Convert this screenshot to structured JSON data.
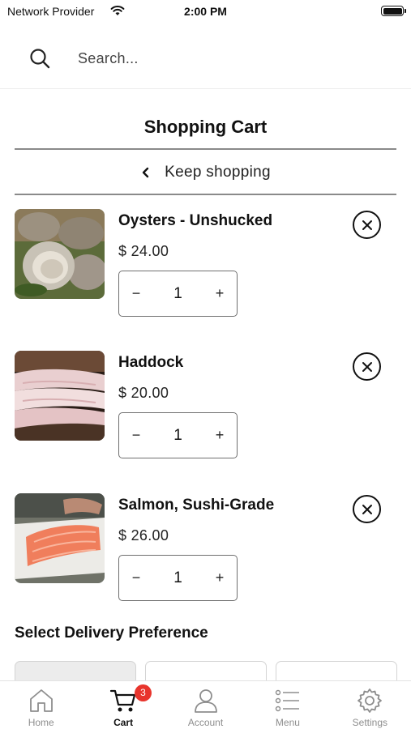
{
  "status_bar": {
    "carrier": "Network Provider",
    "time": "2:00 PM"
  },
  "search": {
    "placeholder": "Search...",
    "icon": "search-icon"
  },
  "header": {
    "title": "Shopping Cart",
    "keep_shopping": "Keep shopping"
  },
  "cart": {
    "items": [
      {
        "name": "Oysters - Unshucked",
        "price": "$ 24.00",
        "quantity": "1",
        "image": "oysters-photo"
      },
      {
        "name": "Haddock",
        "price": "$ 20.00",
        "quantity": "1",
        "image": "haddock-photo"
      },
      {
        "name": "Salmon, Sushi-Grade",
        "price": "$ 26.00",
        "quantity": "1",
        "image": "salmon-photo"
      }
    ],
    "decrement_symbol": "−",
    "increment_symbol": "+"
  },
  "delivery": {
    "title": "Select Delivery Preference"
  },
  "tab_bar": {
    "tabs": [
      {
        "label": "Home",
        "icon": "home-icon"
      },
      {
        "label": "Cart",
        "icon": "cart-icon",
        "active": true,
        "badge": "3"
      },
      {
        "label": "Account",
        "icon": "account-icon"
      },
      {
        "label": "Menu",
        "icon": "menu-list-icon"
      },
      {
        "label": "Settings",
        "icon": "gear-icon"
      }
    ]
  },
  "colors": {
    "badge": "#e8342c",
    "active_tab": "#111111",
    "inactive_tab": "#8e8e8e"
  }
}
